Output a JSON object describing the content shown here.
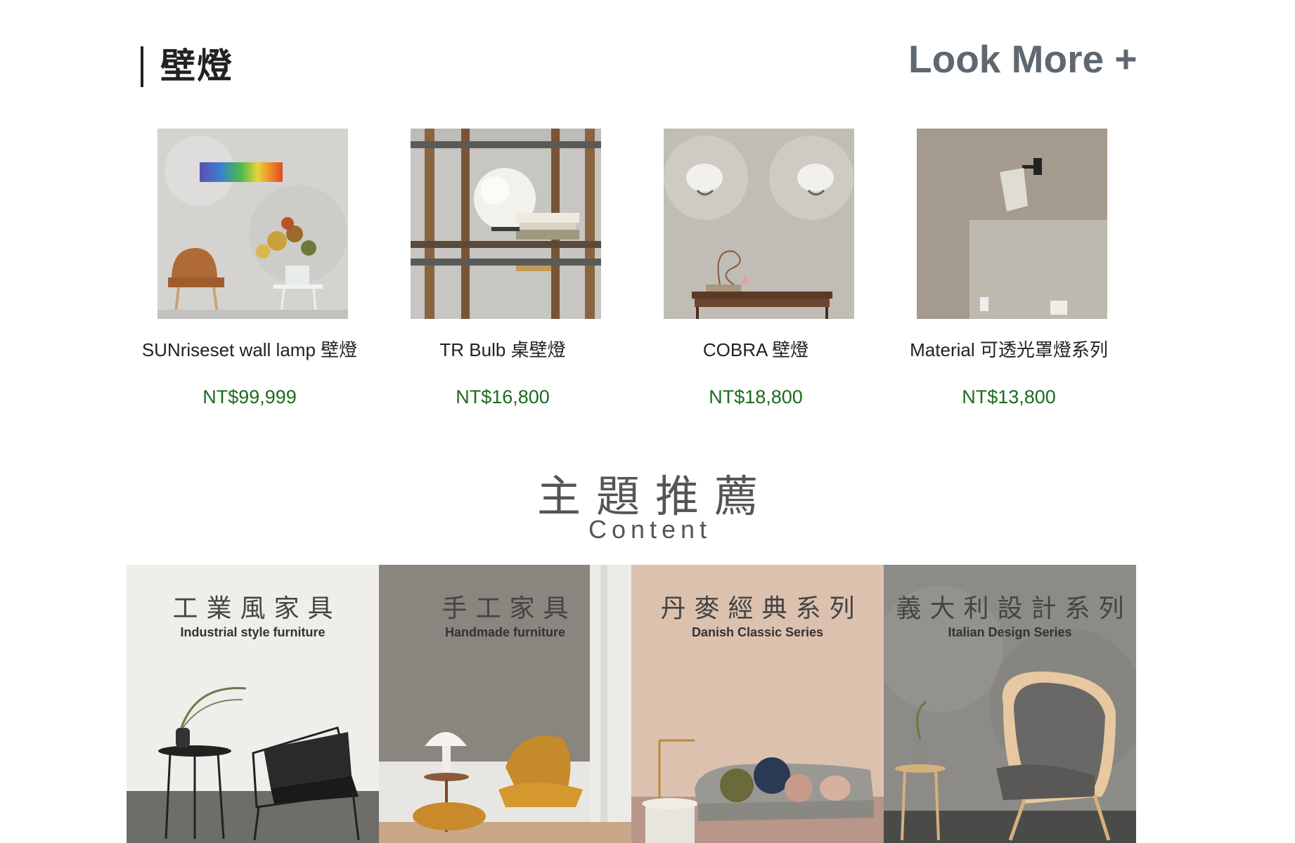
{
  "section": {
    "title": "壁燈",
    "look_more": "Look More +"
  },
  "products": [
    {
      "name": "SUNriseset wall lamp 壁燈",
      "price": "NT$99,999"
    },
    {
      "name": "TR Bulb 桌壁燈",
      "price": "NT$16,800"
    },
    {
      "name": "COBRA 壁燈",
      "price": "NT$18,800"
    },
    {
      "name": "Material 可透光罩燈系列",
      "price": "NT$13,800"
    }
  ],
  "theme": {
    "title": "主題推薦",
    "subtitle": "Content"
  },
  "cards": [
    {
      "title": "工業風家具",
      "subtitle": "Industrial style furniture"
    },
    {
      "title": "手工家具",
      "subtitle": "Handmade furniture"
    },
    {
      "title": "丹麥經典系列",
      "subtitle": "Danish Classic Series"
    },
    {
      "title": "義大利設計系列",
      "subtitle": "Italian Design Series"
    }
  ],
  "colors": {
    "price": "#1d6b1d",
    "look_more": "#5f6870"
  }
}
